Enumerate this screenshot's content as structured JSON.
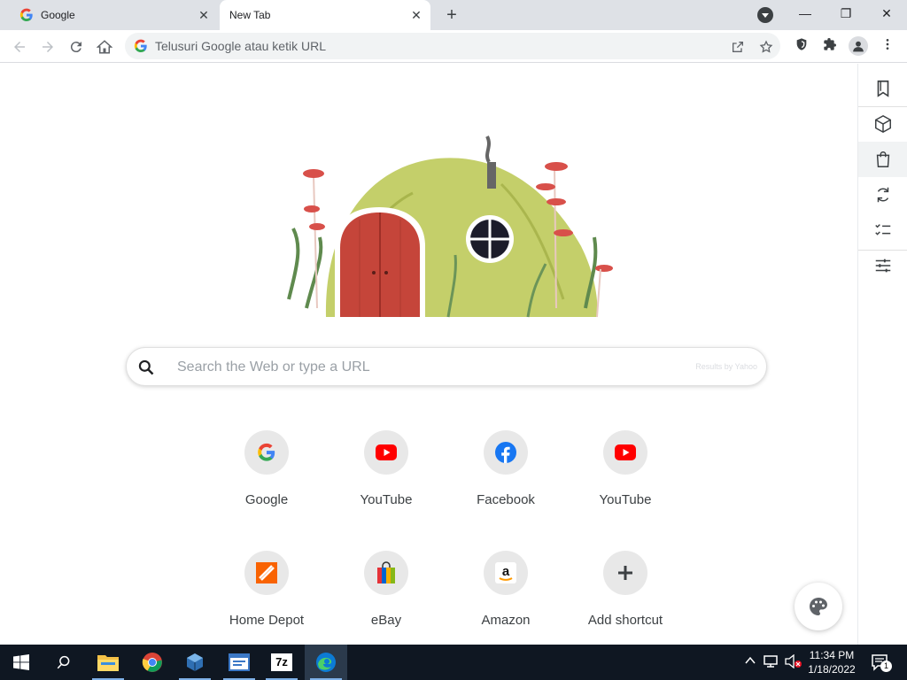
{
  "browser": {
    "tabs": [
      {
        "title": "Google",
        "active": false
      },
      {
        "title": "New Tab",
        "active": true
      }
    ],
    "new_tab_symbol": "+",
    "close_symbol": "✕",
    "omnibox_placeholder": "Telusuri Google atau ketik URL",
    "window_controls": {
      "minimize": "—",
      "restore": "❐",
      "close": "✕"
    }
  },
  "side_panel": {
    "items": [
      "bookmark-icon",
      "package-icon",
      "shopping-bag-icon",
      "sync-icon",
      "checklist-icon",
      "sliders-icon"
    ]
  },
  "new_tab": {
    "search_placeholder": "Search the Web or type a URL",
    "search_provider": "Results by Yahoo",
    "shortcuts": [
      {
        "label": "Google",
        "icon": "google-icon"
      },
      {
        "label": "YouTube",
        "icon": "youtube-icon"
      },
      {
        "label": "Facebook",
        "icon": "facebook-icon"
      },
      {
        "label": "YouTube",
        "icon": "youtube-icon"
      },
      {
        "label": "Home Depot",
        "icon": "home-depot-icon"
      },
      {
        "label": "eBay",
        "icon": "ebay-icon"
      },
      {
        "label": "Amazon",
        "icon": "amazon-icon"
      },
      {
        "label": "Add shortcut",
        "icon": "plus-icon"
      }
    ]
  },
  "taskbar": {
    "time": "11:34 PM",
    "date": "1/18/2022",
    "notification_count": "1",
    "apps": [
      "file-explorer-icon",
      "chrome-icon",
      "virtualbox-icon",
      "app-window-icon",
      "7zip-icon",
      "edge-icon"
    ],
    "sevenzip_label": "7z"
  },
  "colors": {
    "accent": "#1a73e8",
    "youtube_red": "#ff0000",
    "facebook_blue": "#1877f2",
    "home_depot_orange": "#f96302",
    "taskbar_bg": "#0f1722"
  }
}
